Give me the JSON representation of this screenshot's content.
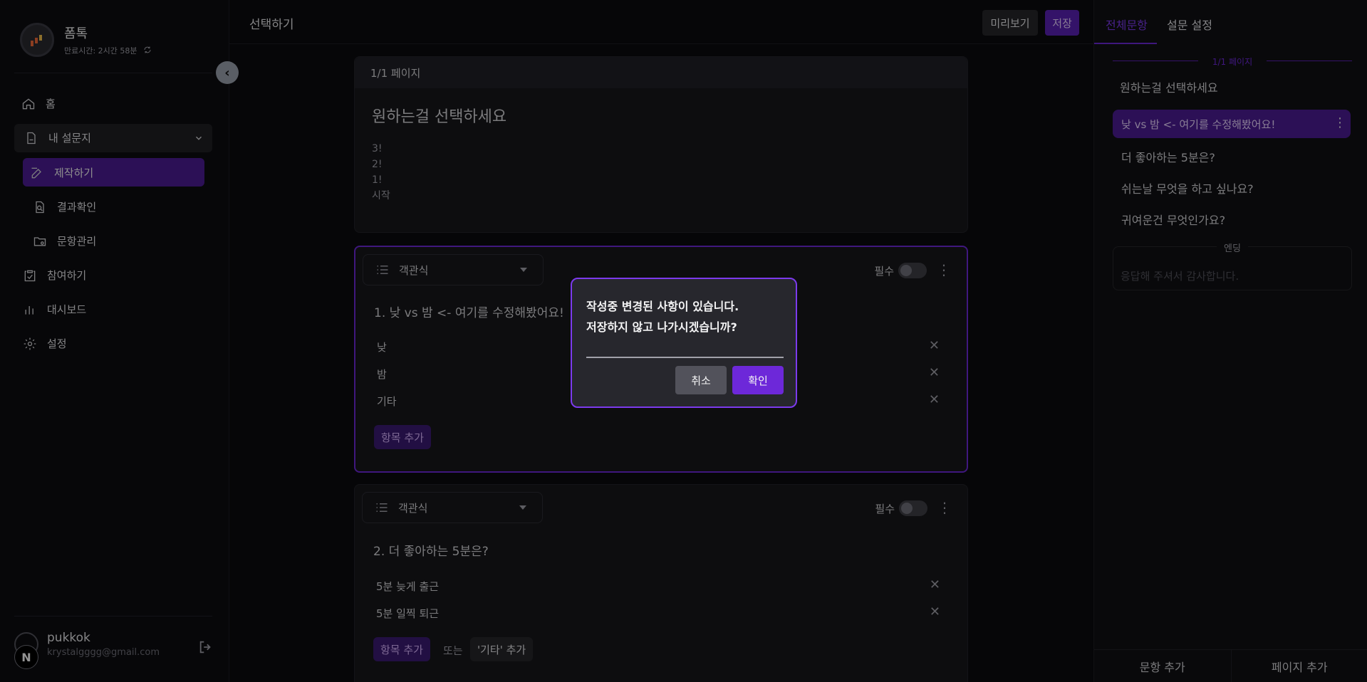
{
  "brand": {
    "name": "폼톡",
    "expire_text": "만료시간: 2시간 58분"
  },
  "sidebar": {
    "items": [
      {
        "label": "홈"
      },
      {
        "label": "내 설문지"
      },
      {
        "label": "제작하기"
      },
      {
        "label": "결과확인"
      },
      {
        "label": "문항관리"
      },
      {
        "label": "참여하기"
      },
      {
        "label": "대시보드"
      },
      {
        "label": "설정"
      }
    ]
  },
  "user": {
    "name": "pukkok",
    "email": "krystalgggg@gmail.com",
    "badge": "N"
  },
  "topbar": {
    "title": "선택하기",
    "preview_label": "미리보기",
    "save_label": "저장"
  },
  "page": {
    "header": "1/1 페이지",
    "title": "원하는걸 선택하세요",
    "desc_lines": [
      "3!",
      "2!",
      "1!",
      "시작"
    ]
  },
  "questions": [
    {
      "type_label": "객관식",
      "required_label": "필수",
      "title": "1.  낮 vs 밤 <- 여기를 수정해봤어요!",
      "options": [
        "낮",
        "밤",
        "기타"
      ],
      "add_label": "항목 추가"
    },
    {
      "type_label": "객관식",
      "required_label": "필수",
      "title": "2.  더 좋아하는 5분은?",
      "options": [
        "5분 늦게 출근",
        "5분 일찍 퇴근"
      ],
      "add_label": "항목 추가",
      "or_label": "또는",
      "etc_label": "'기타' 추가"
    }
  ],
  "right_panel": {
    "tabs": [
      "전체문항",
      "설문 설정"
    ],
    "page_label": "1/1 페이지",
    "items": [
      "원하는걸 선택하세요",
      "낮 vs 밤 <- 여기를 수정해봤어요!",
      "더 좋아하는 5분은?",
      "쉬는날 무엇을 하고 싶나요?",
      "귀여운건 무엇인가요?"
    ],
    "ending_label": "엔딩",
    "ending_placeholder": "응답해 주셔서 감사합니다.",
    "add_question": "문항 추가",
    "add_page": "페이지 추가"
  },
  "dialog": {
    "line1": "작성중 변경된 사항이 있습니다.",
    "line2": "저장하지 않고 나가시겠습니까?",
    "cancel": "취소",
    "confirm": "확인"
  },
  "colors": {
    "accent": "#6d28d9",
    "accent_dark": "#4c1d95",
    "background": "#0b0b0e"
  }
}
